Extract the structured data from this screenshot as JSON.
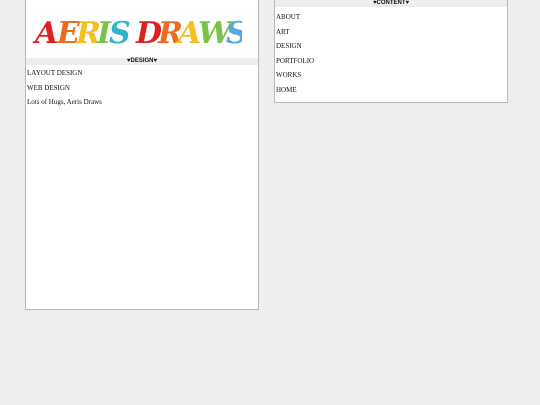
{
  "logo": {
    "text": "AERIS DRAWS",
    "letters": [
      {
        "char": "A",
        "color": "#e02020"
      },
      {
        "char": "E",
        "color": "#f06a20"
      },
      {
        "char": "R",
        "color": "#f4c020"
      },
      {
        "char": "I",
        "color": "#7ac24a"
      },
      {
        "char": "S",
        "color": "#31b3c9"
      },
      {
        "char": "D",
        "color": "#e02020"
      },
      {
        "char": "R",
        "color": "#f06a20"
      },
      {
        "char": "A",
        "color": "#f4c020"
      },
      {
        "char": "W",
        "color": "#7ac24a"
      },
      {
        "char": "S",
        "color": "#56a8e0"
      }
    ]
  },
  "left": {
    "section_title": "♥DESIGN♥",
    "links": [
      "LAYOUT DESIGN",
      "WEB DESIGN"
    ],
    "signature": "Lots of Hugs, Aeris Draws"
  },
  "right": {
    "section_title": "♥CONTENT♥",
    "links": [
      "ABOUT",
      "ART",
      "DESIGN",
      "PORTFOLIO",
      "WORKS",
      "HOME"
    ]
  }
}
